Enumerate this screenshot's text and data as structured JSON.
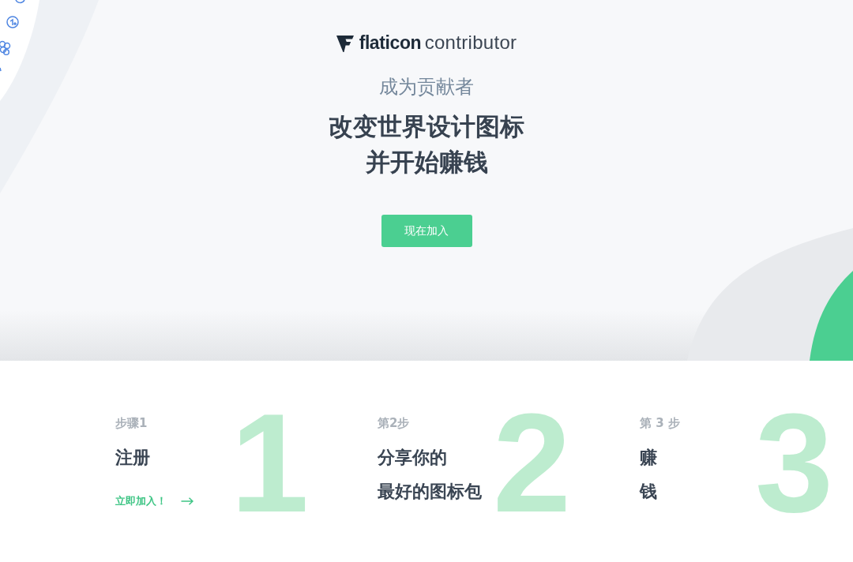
{
  "logo": {
    "brand": "flaticon",
    "suffix": "contributor"
  },
  "hero": {
    "eyebrow": "成为贡献者",
    "headline": [
      "改变世界设计图标",
      "并开始赚钱"
    ],
    "cta": "现在加入"
  },
  "steps": [
    {
      "label": "步骤1",
      "number": "1",
      "title": [
        "注册"
      ],
      "link": "立即加入！"
    },
    {
      "label": "第2步",
      "number": "2",
      "title": [
        "分享你的",
        "最好的图标包"
      ]
    },
    {
      "label": "第 3 步",
      "number": "3",
      "title": [
        "赚",
        "钱"
      ]
    }
  ]
}
